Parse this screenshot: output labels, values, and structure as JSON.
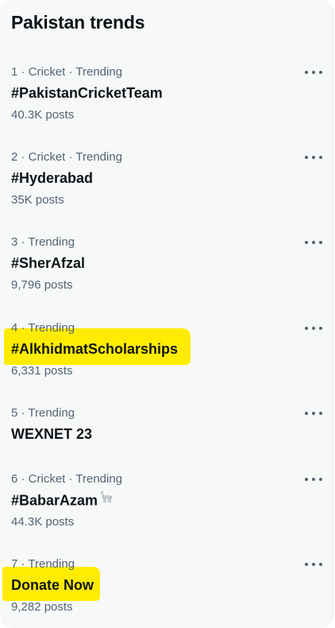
{
  "panel": {
    "title": "Pakistan trends"
  },
  "trends": [
    {
      "meta": "1 · Cricket · Trending",
      "name": "#PakistanCricketTeam",
      "count": "40.3K posts"
    },
    {
      "meta": "2 · Cricket · Trending",
      "name": "#Hyderabad",
      "count": "35K posts"
    },
    {
      "meta": "3 · Trending",
      "name": "#SherAfzal",
      "count": "9,796 posts"
    },
    {
      "meta": "4 · Trending",
      "name": "#AlkhidmatScholarships",
      "count": "6,331 posts"
    },
    {
      "meta": "5 · Trending",
      "name": "WEXNET 23",
      "count": ""
    },
    {
      "meta": "6 · Cricket · Trending",
      "name": "#BabarAzam",
      "count": "44.3K posts"
    },
    {
      "meta": "7 · Trending",
      "name": "Donate Now",
      "count": "9,282 posts"
    }
  ],
  "icons": {
    "more": "more-horizontal-icon",
    "goat": "goat-emoji-icon"
  },
  "colors": {
    "background": "#f7f9f9",
    "text": "#0f1419",
    "muted": "#536471",
    "highlight": "#ffec00"
  }
}
